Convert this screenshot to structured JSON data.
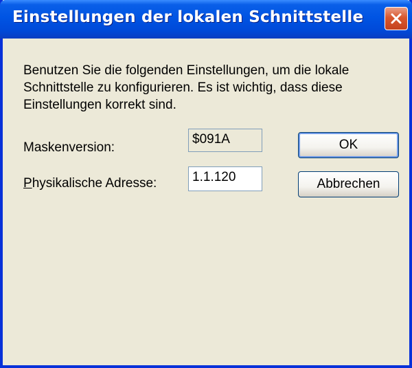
{
  "window": {
    "title": "Einstellungen der lokalen Schnittstelle",
    "close_icon": "close-icon"
  },
  "description": "Benutzen Sie die folgenden Einstellungen, um die lokale Schnittstelle zu konfigurieren. Es ist wichtig, dass diese Einstellungen korrekt sind.",
  "fields": {
    "mask_version": {
      "label": "Maskenversion:",
      "value": "$091A"
    },
    "physical_address": {
      "label_mnemonic": "P",
      "label_rest": "hysikalische Adresse:",
      "value": "1.1.120"
    }
  },
  "buttons": {
    "ok": "OK",
    "cancel": "Abbrechen"
  },
  "colors": {
    "titlebar": "#0054E3",
    "dialog_bg": "#ECE9D8",
    "close_button": "#D9582E"
  }
}
